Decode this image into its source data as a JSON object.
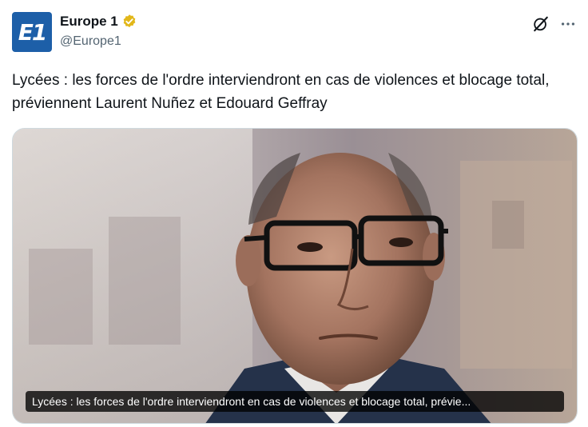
{
  "account": {
    "display_name": "Europe 1",
    "handle": "@Europe1",
    "avatar_text": "E1",
    "verified": true,
    "verified_color": "#e2b719",
    "avatar_color": "#1d5fa8"
  },
  "tweet": {
    "text": "Lycées : les forces de l'ordre interviendront en cas de violences et blocage total, préviennent Laurent Nuñez et Edouard Geffray"
  },
  "media": {
    "caption": "Lycées : les forces de l'ordre interviendront en cas de violences et blocage total, prévie..."
  },
  "icons": {
    "verified": "verified-badge-icon",
    "grok": "grok-icon",
    "more": "more-icon"
  }
}
